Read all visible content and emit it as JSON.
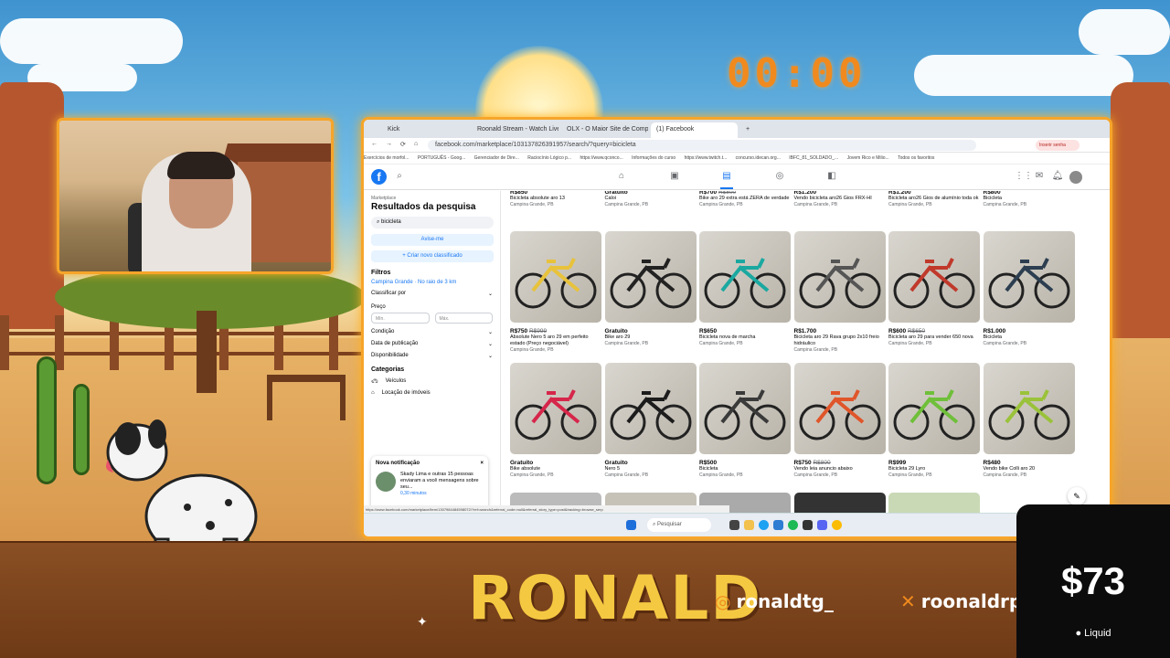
{
  "overlay": {
    "timer": "00:00",
    "brand": "RONALD",
    "instagram": "ronaldtg_",
    "x_handle": "roonaldrp",
    "donation_amount": "$73",
    "donation_provider": "Liquid"
  },
  "browser": {
    "tabs": [
      "Kick",
      "Roonald Stream - Watch Live on...",
      "OLX - O Maior Site de Compra...",
      "(1) Facebook"
    ],
    "url": "facebook.com/marketplace/103137826391957/search/?query=bicicleta",
    "bookmarks": [
      "Exercícios de morfol...",
      "PORTUGUÊS - Goog...",
      "Gerenciador de Dire...",
      "Raciocínio Lógico p...",
      "https://www.qconco...",
      "Informações do curso",
      "https://www.twitch.t...",
      "concurso.idecan.org...",
      "IBFC_81_SOLDADO_...",
      "Jovem Rico e Milio...",
      "Todos os favoritos"
    ],
    "profile_badge": "Inserir senha"
  },
  "sidebar": {
    "section": "Marketplace",
    "title": "Resultados da pesquisa",
    "search_value": "bicicleta",
    "notify_button": "Avise-me",
    "create_button": "+ Criar novo classificado",
    "filters_heading": "Filtros",
    "location": "Campina Grande · No raio de 3 km",
    "sort_label": "Classificar por",
    "price_label": "Preço",
    "min_placeholder": "Mín.",
    "max_placeholder": "Máx.",
    "condition_label": "Condição",
    "date_label": "Data de publicação",
    "availability_label": "Disponibilidade",
    "categories_heading": "Categorias",
    "cat_vehicles": "Veículos",
    "cat_rentals": "Locação de imóveis"
  },
  "notification": {
    "heading": "Nova notificação",
    "text": "Skady Lima e outras 15 pessoas enviaram a você mensagens sobre seu...",
    "time": "0,30 minutos"
  },
  "listings_top": [
    {
      "price": "R$850",
      "old": "",
      "title": "Bicicleta absolute aro 13",
      "loc": "Campina Grande, PB"
    },
    {
      "price": "Gratuito",
      "old": "",
      "title": "Caloi",
      "loc": "Campina Grande, PB"
    },
    {
      "price": "R$700",
      "old": "R$800",
      "title": "Bike aro 29 extra está ZERA de verdade",
      "loc": "Campina Grande, PB"
    },
    {
      "price": "R$1.200",
      "old": "",
      "title": "Vendo bicicleta aro26 Gios FRX-HI",
      "loc": "Campina Grande, PB"
    },
    {
      "price": "R$1.200",
      "old": "",
      "title": "Bicicleta aro26 Gios de alumínio toda ok",
      "loc": "Campina Grande, PB"
    },
    {
      "price": "R$800",
      "old": "",
      "title": "Bicicleta",
      "loc": "Campina Grande, PB"
    }
  ],
  "listings_row2": [
    {
      "price": "R$750",
      "old": "R$999",
      "title": "Absolute Nero 5 aro 29 em perfeito estado (Preço negociável)",
      "loc": "Campina Grande, PB",
      "color": "#e8c23a"
    },
    {
      "price": "Gratuito",
      "old": "",
      "title": "Bike aro 29",
      "loc": "Campina Grande, PB",
      "color": "#222222"
    },
    {
      "price": "R$650",
      "old": "",
      "title": "Bicicleta nova de marcha",
      "loc": "Campina Grande, PB",
      "color": "#1aa8a0"
    },
    {
      "price": "R$1.700",
      "old": "",
      "title": "Bicicleta aro 29 Rava grupo 2x10 freio hidráulico",
      "loc": "Campina Grande, PB",
      "color": "#555555"
    },
    {
      "price": "R$600",
      "old": "R$650",
      "title": "Bicicleta aro 29 para vender 650 nova",
      "loc": "Campina Grande, PB",
      "color": "#c0392b"
    },
    {
      "price": "R$1.000",
      "old": "",
      "title": "Bicicleta",
      "loc": "Campina Grande, PB",
      "color": "#2c3e50"
    }
  ],
  "listings_row3": [
    {
      "price": "Gratuito",
      "old": "",
      "title": "Bike absolute",
      "loc": "Campina Grande, PB",
      "color": "#d6264a"
    },
    {
      "price": "Gratuito",
      "old": "",
      "title": "Nero 5",
      "loc": "Campina Grande, PB",
      "color": "#1c1c1c"
    },
    {
      "price": "R$500",
      "old": "",
      "title": "Bicicleta",
      "loc": "Campina Grande, PB",
      "color": "#3a3a3a"
    },
    {
      "price": "R$750",
      "old": "R$800",
      "title": "Vendo leia anuncio abaixo",
      "loc": "Campina Grande, PB",
      "color": "#e0552a"
    },
    {
      "price": "R$999",
      "old": "",
      "title": "Bicicleta 29 Lyro",
      "loc": "Campina Grande, PB",
      "color": "#6fbf3a"
    },
    {
      "price": "R$480",
      "old": "",
      "title": "Vendo bike Colli aro 20",
      "loc": "Campina Grande, PB",
      "color": "#9ac23a"
    }
  ],
  "status_url": "https://www.facebook.com/marketplace/item/1307984484598072/?ref=search&referral_code=null&referral_story_type=post&tracking=browse_serp",
  "taskbar": {
    "search": "Pesquisar"
  }
}
